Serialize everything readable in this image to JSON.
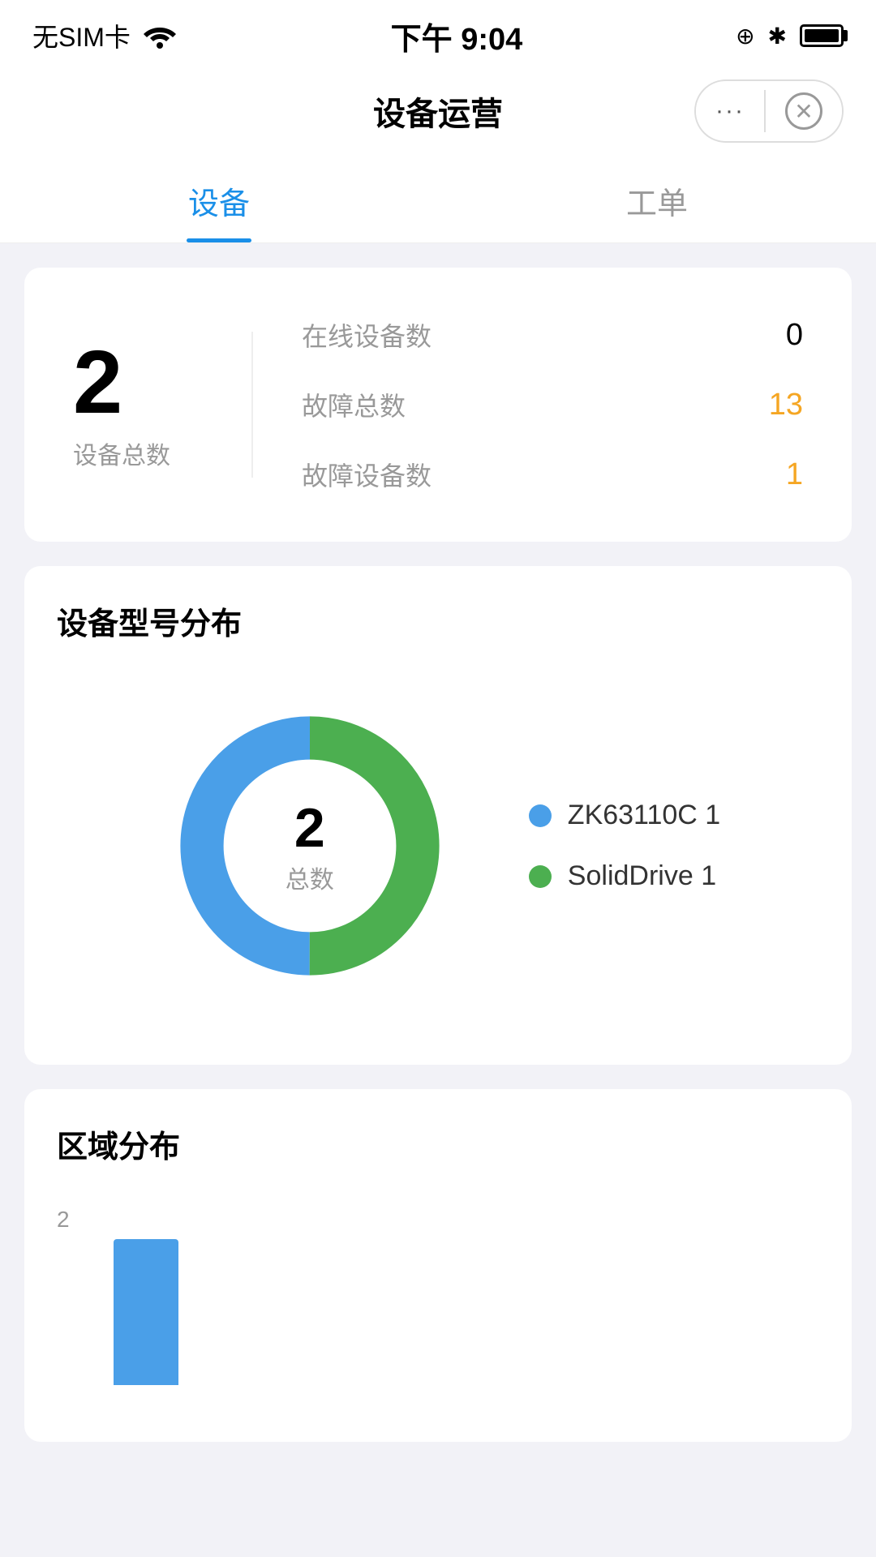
{
  "statusBar": {
    "carrier": "无SIM卡",
    "time": "下午 9:04",
    "lockIcon": "🔒",
    "bluetoothIcon": "✱"
  },
  "header": {
    "title": "设备运营",
    "moreLabel": "···",
    "closeLabel": "✕"
  },
  "tabs": [
    {
      "id": "device",
      "label": "设备",
      "active": true
    },
    {
      "id": "workorder",
      "label": "工单",
      "active": false
    }
  ],
  "statsCard": {
    "totalNumber": "2",
    "totalLabel": "设备总数",
    "items": [
      {
        "label": "在线设备数",
        "value": "0",
        "type": "normal"
      },
      {
        "label": "故障总数",
        "value": "13",
        "type": "warning"
      },
      {
        "label": "故障设备数",
        "value": "1",
        "type": "warning"
      }
    ]
  },
  "modelDistribution": {
    "title": "设备型号分布",
    "centerNumber": "2",
    "centerLabel": "总数",
    "segments": [
      {
        "name": "ZK63110C",
        "value": 1,
        "color": "#4a9fe8",
        "percent": 50
      },
      {
        "name": "SolidDrive",
        "value": 1,
        "color": "#4caf50",
        "percent": 50
      }
    ]
  },
  "regionDistribution": {
    "title": "区域分布",
    "yMax": 2,
    "bars": [
      {
        "label": "",
        "value": 2
      }
    ]
  }
}
